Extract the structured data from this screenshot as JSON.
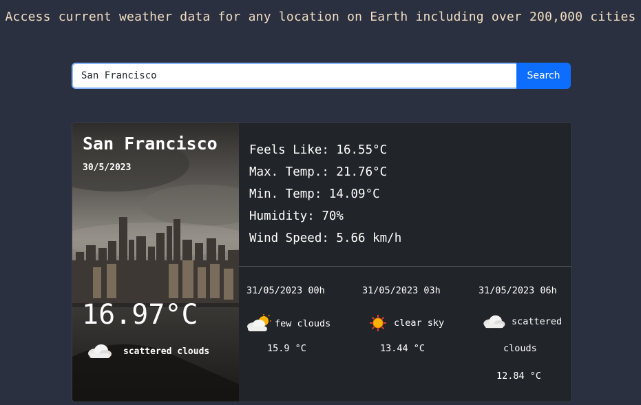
{
  "header": {
    "tagline": "Access current weather data for any location on Earth including over 200,000 cities"
  },
  "search": {
    "value": "San Francisco",
    "button_label": "Search"
  },
  "current": {
    "city": "San Francisco",
    "date": "30/5/2023",
    "temp": "16.97°C",
    "description": "scattered clouds",
    "icon": "scattered-clouds-icon",
    "details": {
      "feels_like": "Feels Like: 16.55°C",
      "max_temp": "Max. Temp.: 21.76°C",
      "min_temp": "Min. Temp: 14.09°C",
      "humidity": "Humidity: 70%",
      "wind_speed": "Wind Speed: 5.66 km/h"
    }
  },
  "forecast": [
    {
      "time": "31/05/2023 00h",
      "icon": "few-clouds-icon",
      "description": "few clouds",
      "temp": "15.9 °C"
    },
    {
      "time": "31/05/2023 03h",
      "icon": "clear-sky-icon",
      "description": "clear sky",
      "temp": "13.44 °C"
    },
    {
      "time": "31/05/2023 06h",
      "icon": "scattered-clouds-icon",
      "description_line1": "scattered",
      "description_line2": "clouds",
      "temp": "12.84 °C"
    }
  ]
}
